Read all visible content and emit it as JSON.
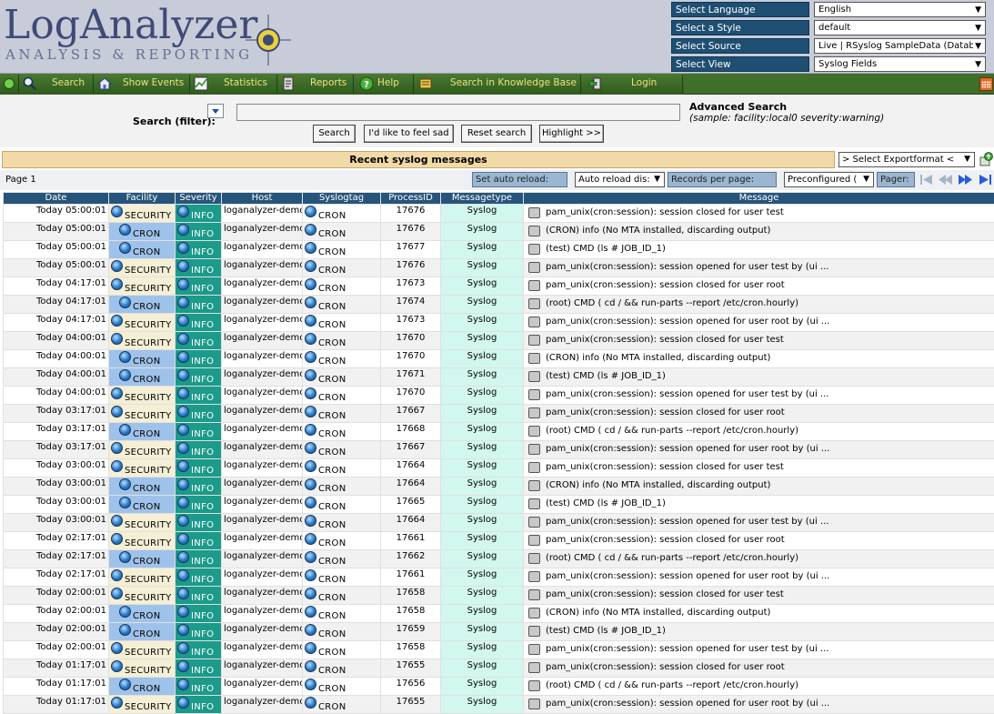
{
  "header": {
    "logo_title": "LogAnalyzer",
    "logo_subtitle": "ANALYSIS & REPORTING",
    "selectors": [
      {
        "label": "Select Language",
        "value": "English"
      },
      {
        "label": "Select a Style",
        "value": "default"
      },
      {
        "label": "Select Source",
        "value": "Live | RSyslog SampleData (Datab"
      },
      {
        "label": "Select View",
        "value": "Syslog Fields"
      }
    ]
  },
  "menu": {
    "items": [
      "Search",
      "Show Events",
      "Statistics",
      "Reports",
      "Help",
      "Search in Knowledge Base",
      "Login"
    ]
  },
  "search": {
    "label": "Search (filter):",
    "input_value": "",
    "buttons": [
      "Search",
      "I'd like to feel sad",
      "Reset search",
      "Highlight >>"
    ],
    "advanced_title": "Advanced Search",
    "advanced_sample": "(sample: facility:local0 severity:warning)"
  },
  "recent": {
    "title": "Recent syslog messages",
    "export_select": "> Select Exportformat <"
  },
  "pager": {
    "page_label": "Page 1",
    "auto_reload_label": "Set auto reload:",
    "auto_reload_value": "Auto reload dis:",
    "records_label": "Records per page:",
    "records_value": "Preconfigured (",
    "pager_label": "Pager:"
  },
  "table": {
    "columns": [
      "Date",
      "Facility",
      "Severity",
      "Host",
      "Syslogtag",
      "ProcessID",
      "Messagetype",
      "Message"
    ],
    "rows": [
      {
        "date": "Today 05:00:01",
        "facility": "SECURITY",
        "severity": "INFO",
        "host": "loganalyzer-demo",
        "tag": "CRON",
        "pid": "17676",
        "type": "Syslog",
        "message": "pam_unix(cron:session): session closed for user test"
      },
      {
        "date": "Today 05:00:01",
        "facility": "CRON",
        "severity": "INFO",
        "host": "loganalyzer-demo",
        "tag": "CRON",
        "pid": "17676",
        "type": "Syslog",
        "message": "(CRON) info (No MTA installed, discarding output)"
      },
      {
        "date": "Today 05:00:01",
        "facility": "CRON",
        "severity": "INFO",
        "host": "loganalyzer-demo",
        "tag": "CRON",
        "pid": "17677",
        "type": "Syslog",
        "message": "(test) CMD (ls # JOB_ID_1)"
      },
      {
        "date": "Today 05:00:01",
        "facility": "SECURITY",
        "severity": "INFO",
        "host": "loganalyzer-demo",
        "tag": "CRON",
        "pid": "17676",
        "type": "Syslog",
        "message": "pam_unix(cron:session): session opened for user test by (ui ..."
      },
      {
        "date": "Today 04:17:01",
        "facility": "SECURITY",
        "severity": "INFO",
        "host": "loganalyzer-demo",
        "tag": "CRON",
        "pid": "17673",
        "type": "Syslog",
        "message": "pam_unix(cron:session): session closed for user root"
      },
      {
        "date": "Today 04:17:01",
        "facility": "CRON",
        "severity": "INFO",
        "host": "loganalyzer-demo",
        "tag": "CRON",
        "pid": "17674",
        "type": "Syslog",
        "message": "(root) CMD ( cd / && run-parts --report /etc/cron.hourly)"
      },
      {
        "date": "Today 04:17:01",
        "facility": "SECURITY",
        "severity": "INFO",
        "host": "loganalyzer-demo",
        "tag": "CRON",
        "pid": "17673",
        "type": "Syslog",
        "message": "pam_unix(cron:session): session opened for user root by (ui ..."
      },
      {
        "date": "Today 04:00:01",
        "facility": "SECURITY",
        "severity": "INFO",
        "host": "loganalyzer-demo",
        "tag": "CRON",
        "pid": "17670",
        "type": "Syslog",
        "message": "pam_unix(cron:session): session closed for user test"
      },
      {
        "date": "Today 04:00:01",
        "facility": "CRON",
        "severity": "INFO",
        "host": "loganalyzer-demo",
        "tag": "CRON",
        "pid": "17670",
        "type": "Syslog",
        "message": "(CRON) info (No MTA installed, discarding output)"
      },
      {
        "date": "Today 04:00:01",
        "facility": "CRON",
        "severity": "INFO",
        "host": "loganalyzer-demo",
        "tag": "CRON",
        "pid": "17671",
        "type": "Syslog",
        "message": "(test) CMD (ls # JOB_ID_1)"
      },
      {
        "date": "Today 04:00:01",
        "facility": "SECURITY",
        "severity": "INFO",
        "host": "loganalyzer-demo",
        "tag": "CRON",
        "pid": "17670",
        "type": "Syslog",
        "message": "pam_unix(cron:session): session opened for user test by (ui ..."
      },
      {
        "date": "Today 03:17:01",
        "facility": "SECURITY",
        "severity": "INFO",
        "host": "loganalyzer-demo",
        "tag": "CRON",
        "pid": "17667",
        "type": "Syslog",
        "message": "pam_unix(cron:session): session closed for user root"
      },
      {
        "date": "Today 03:17:01",
        "facility": "CRON",
        "severity": "INFO",
        "host": "loganalyzer-demo",
        "tag": "CRON",
        "pid": "17668",
        "type": "Syslog",
        "message": "(root) CMD ( cd / && run-parts --report /etc/cron.hourly)"
      },
      {
        "date": "Today 03:17:01",
        "facility": "SECURITY",
        "severity": "INFO",
        "host": "loganalyzer-demo",
        "tag": "CRON",
        "pid": "17667",
        "type": "Syslog",
        "message": "pam_unix(cron:session): session opened for user root by (ui ..."
      },
      {
        "date": "Today 03:00:01",
        "facility": "SECURITY",
        "severity": "INFO",
        "host": "loganalyzer-demo",
        "tag": "CRON",
        "pid": "17664",
        "type": "Syslog",
        "message": "pam_unix(cron:session): session closed for user test"
      },
      {
        "date": "Today 03:00:01",
        "facility": "CRON",
        "severity": "INFO",
        "host": "loganalyzer-demo",
        "tag": "CRON",
        "pid": "17664",
        "type": "Syslog",
        "message": "(CRON) info (No MTA installed, discarding output)"
      },
      {
        "date": "Today 03:00:01",
        "facility": "CRON",
        "severity": "INFO",
        "host": "loganalyzer-demo",
        "tag": "CRON",
        "pid": "17665",
        "type": "Syslog",
        "message": "(test) CMD (ls # JOB_ID_1)"
      },
      {
        "date": "Today 03:00:01",
        "facility": "SECURITY",
        "severity": "INFO",
        "host": "loganalyzer-demo",
        "tag": "CRON",
        "pid": "17664",
        "type": "Syslog",
        "message": "pam_unix(cron:session): session opened for user test by (ui ..."
      },
      {
        "date": "Today 02:17:01",
        "facility": "SECURITY",
        "severity": "INFO",
        "host": "loganalyzer-demo",
        "tag": "CRON",
        "pid": "17661",
        "type": "Syslog",
        "message": "pam_unix(cron:session): session closed for user root"
      },
      {
        "date": "Today 02:17:01",
        "facility": "CRON",
        "severity": "INFO",
        "host": "loganalyzer-demo",
        "tag": "CRON",
        "pid": "17662",
        "type": "Syslog",
        "message": "(root) CMD ( cd / && run-parts --report /etc/cron.hourly)"
      },
      {
        "date": "Today 02:17:01",
        "facility": "SECURITY",
        "severity": "INFO",
        "host": "loganalyzer-demo",
        "tag": "CRON",
        "pid": "17661",
        "type": "Syslog",
        "message": "pam_unix(cron:session): session opened for user root by (ui ..."
      },
      {
        "date": "Today 02:00:01",
        "facility": "SECURITY",
        "severity": "INFO",
        "host": "loganalyzer-demo",
        "tag": "CRON",
        "pid": "17658",
        "type": "Syslog",
        "message": "pam_unix(cron:session): session closed for user test"
      },
      {
        "date": "Today 02:00:01",
        "facility": "CRON",
        "severity": "INFO",
        "host": "loganalyzer-demo",
        "tag": "CRON",
        "pid": "17658",
        "type": "Syslog",
        "message": "(CRON) info (No MTA installed, discarding output)"
      },
      {
        "date": "Today 02:00:01",
        "facility": "CRON",
        "severity": "INFO",
        "host": "loganalyzer-demo",
        "tag": "CRON",
        "pid": "17659",
        "type": "Syslog",
        "message": "(test) CMD (ls # JOB_ID_1)"
      },
      {
        "date": "Today 02:00:01",
        "facility": "SECURITY",
        "severity": "INFO",
        "host": "loganalyzer-demo",
        "tag": "CRON",
        "pid": "17658",
        "type": "Syslog",
        "message": "pam_unix(cron:session): session opened for user test by (ui ..."
      },
      {
        "date": "Today 01:17:01",
        "facility": "SECURITY",
        "severity": "INFO",
        "host": "loganalyzer-demo",
        "tag": "CRON",
        "pid": "17655",
        "type": "Syslog",
        "message": "pam_unix(cron:session): session closed for user root"
      },
      {
        "date": "Today 01:17:01",
        "facility": "CRON",
        "severity": "INFO",
        "host": "loganalyzer-demo",
        "tag": "CRON",
        "pid": "17656",
        "type": "Syslog",
        "message": "(root) CMD ( cd / && run-parts --report /etc/cron.hourly)"
      },
      {
        "date": "Today 01:17:01",
        "facility": "SECURITY",
        "severity": "INFO",
        "host": "loganalyzer-demo",
        "tag": "CRON",
        "pid": "17655",
        "type": "Syslog",
        "message": "pam_unix(cron:session): session opened for user root by (ui ..."
      }
    ]
  },
  "colors": {
    "menu_text": "#e8e37a",
    "header_bg": "#c8ccd8",
    "selector_label_bg": "#1f4f72",
    "table_header_bg": "#27547a",
    "facility_security_bg": "#f5efd6",
    "facility_cron_bg": "#9fc2ea",
    "severity_info_bg": "#1c9a8a",
    "messagetype_bg": "#d2f7ee"
  }
}
